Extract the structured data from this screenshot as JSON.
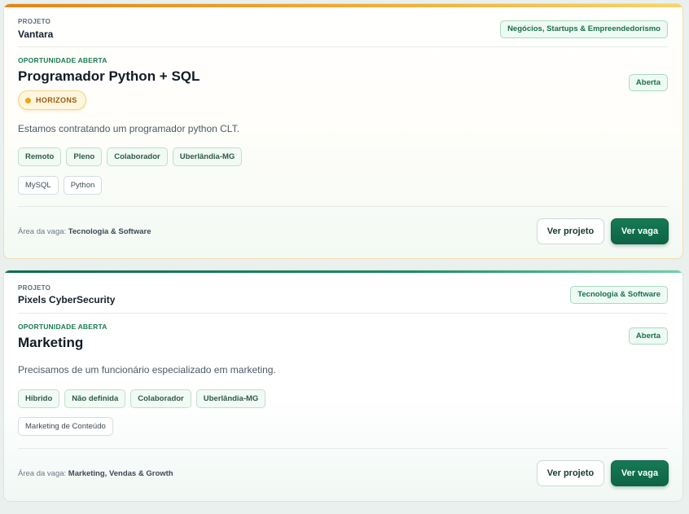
{
  "cards": [
    {
      "project_label": "PROJETO",
      "project_name": "Vantara",
      "category": "Negócios, Startups & Empreendedorismo",
      "opportunity_label": "OPORTUNIDADE ABERTA",
      "job_title": "Programador Python + SQL",
      "status": "Aberta",
      "program_badge": "HORIZONS",
      "description": "Estamos contratando um programador python CLT.",
      "tags": [
        "Remoto",
        "Pleno",
        "Colaborador",
        "Uberlândia-MG"
      ],
      "skills": [
        "MySQL",
        "Python"
      ],
      "area_label": "Área da vaga:",
      "area_value": "Tecnologia & Software",
      "view_project_label": "Ver projeto",
      "view_job_label": "Ver vaga"
    },
    {
      "project_label": "PROJETO",
      "project_name": "Pixels CyberSecurity",
      "category": "Tecnologia & Software",
      "opportunity_label": "OPORTUNIDADE ABERTA",
      "job_title": "Marketing",
      "status": "Aberta",
      "description": "Precisamos de um funcionário especializado em marketing.",
      "tags": [
        "Híbrido",
        "Não definida",
        "Colaborador",
        "Uberlândia-MG"
      ],
      "skills": [
        "Marketing de Conteúdo"
      ],
      "area_label": "Área da vaga:",
      "area_value": "Marketing, Vendas & Growth",
      "view_project_label": "Ver projeto",
      "view_job_label": "Ver vaga"
    }
  ]
}
